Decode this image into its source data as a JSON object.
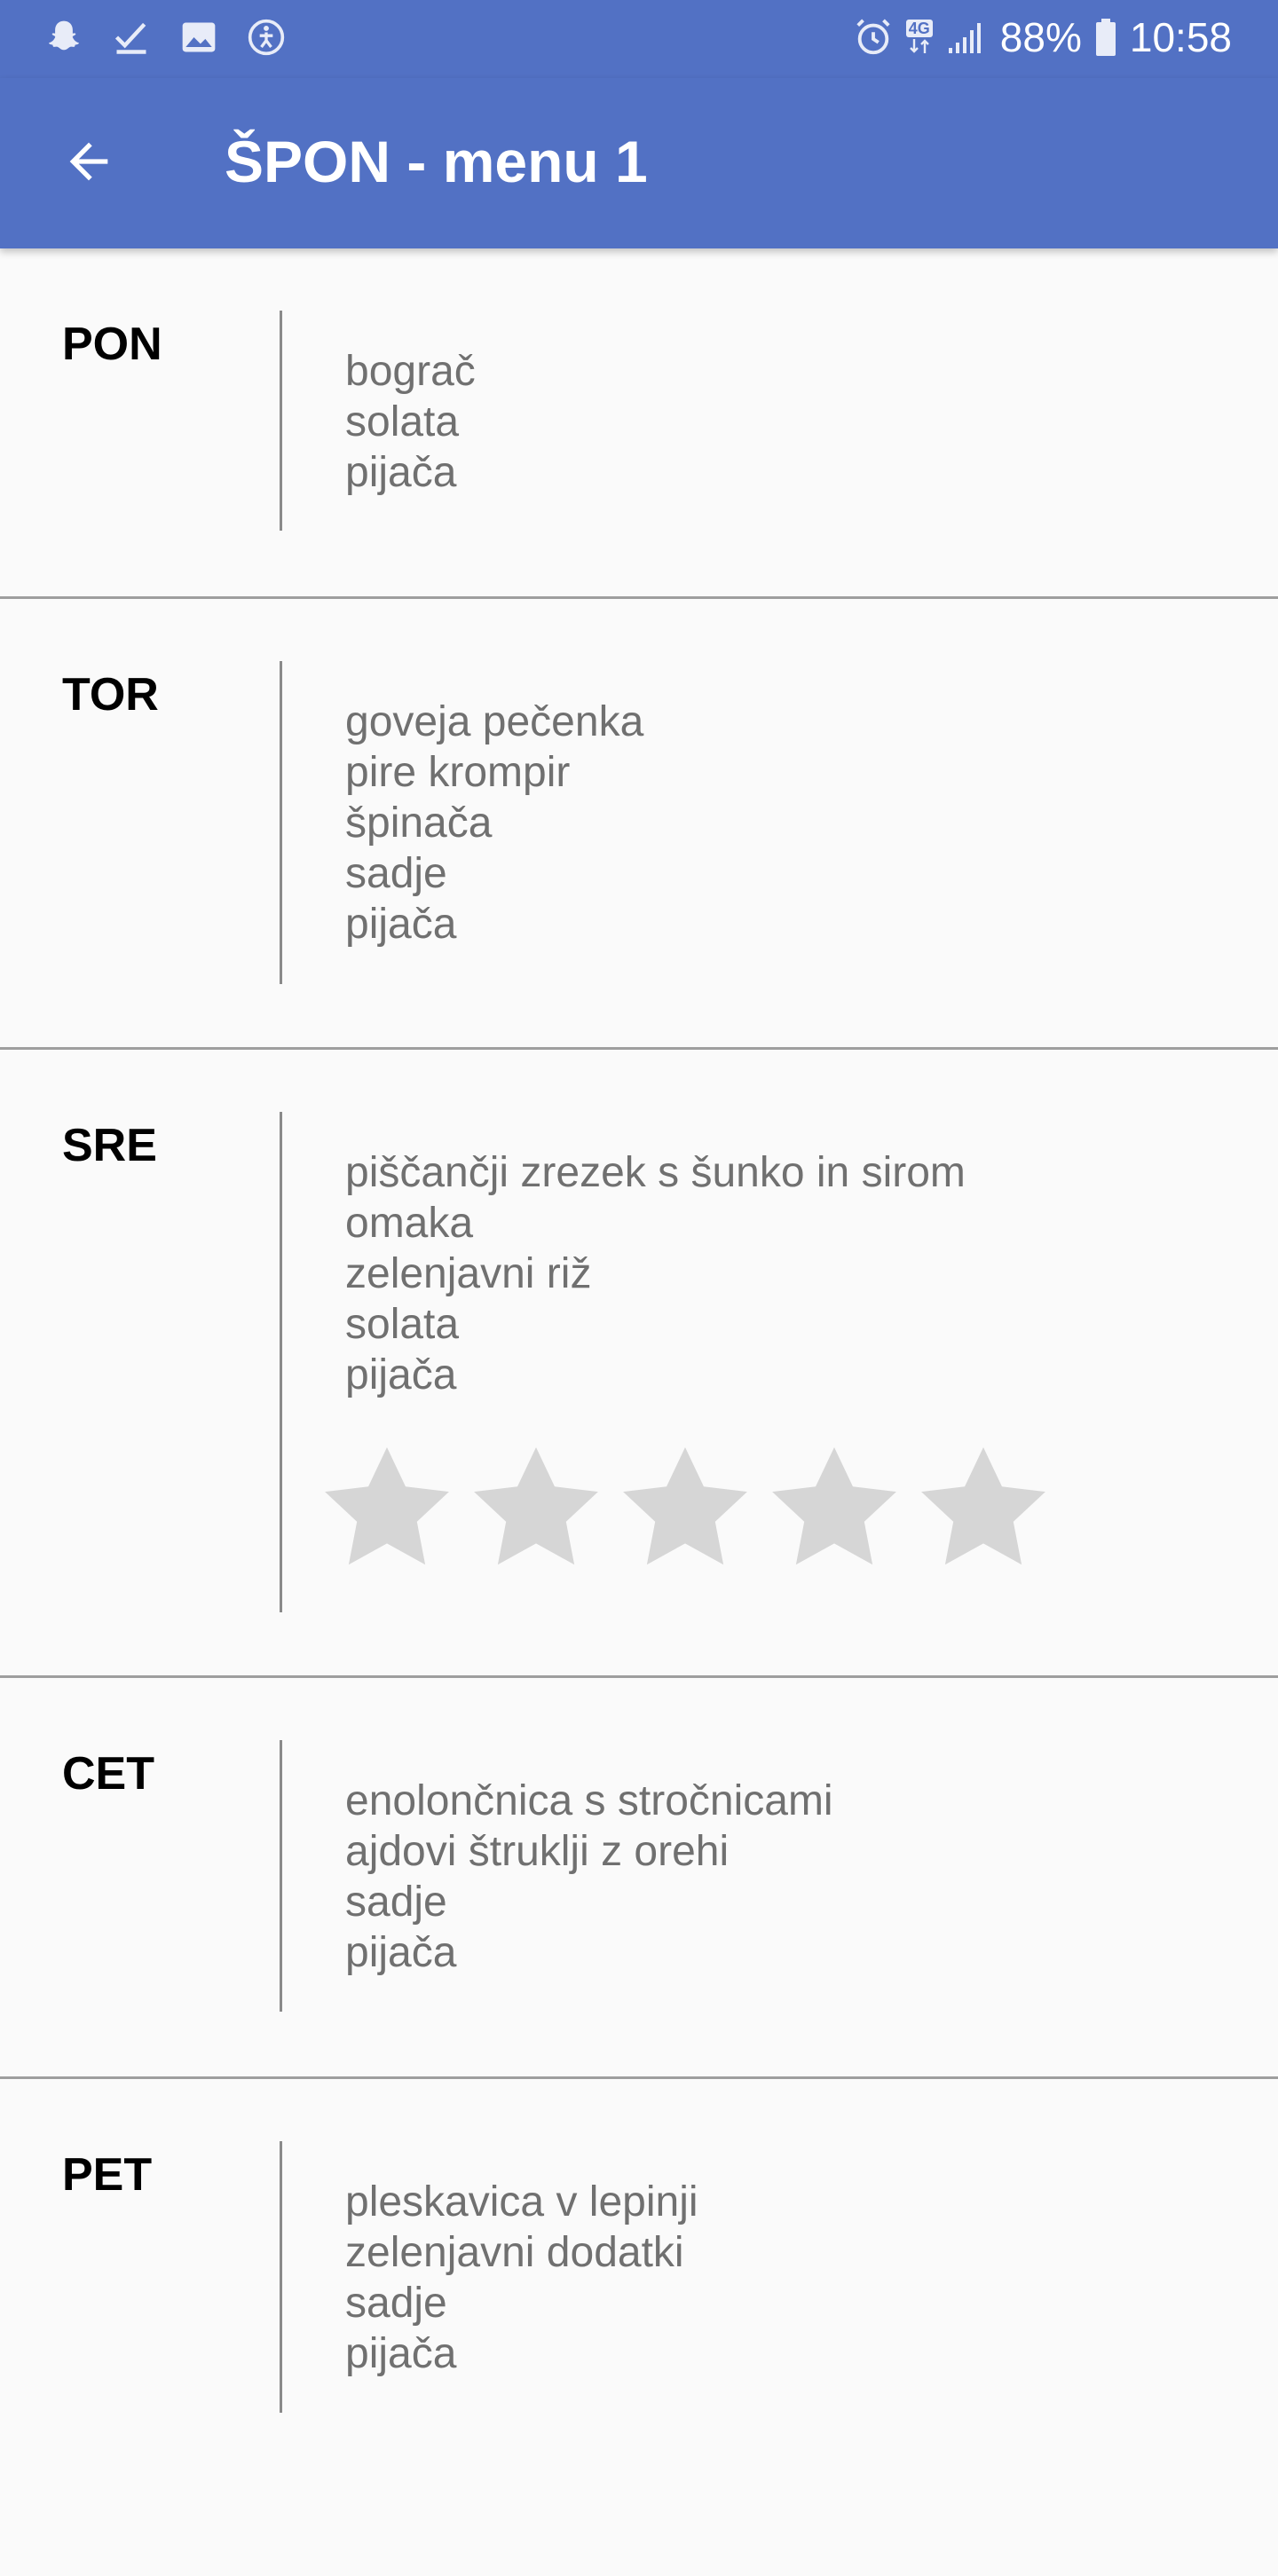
{
  "status_bar": {
    "battery": "88%",
    "time": "10:58",
    "network_badge": "4G",
    "left_icons": [
      "snapchat-icon",
      "check-icon",
      "image-icon",
      "accessibility-icon"
    ],
    "right_icons": [
      "alarm-icon",
      "signal-icon",
      "battery-icon"
    ]
  },
  "toolbar": {
    "title": "ŠPON - menu 1",
    "back_icon": "arrow-back-icon"
  },
  "colors": {
    "primary": "#5271c4",
    "background": "#fafafa",
    "item_text": "#707070",
    "star_empty": "#d6d6d6"
  },
  "days": [
    {
      "label": "PON",
      "items": [
        "bograč",
        "solata",
        "pijača"
      ]
    },
    {
      "label": "TOR",
      "items": [
        "goveja pečenka",
        "pire krompir",
        "špinača",
        "sadje",
        "pijača"
      ]
    },
    {
      "label": "SRE",
      "items": [
        "piščančji zrezek s šunko in sirom",
        "omaka",
        "zelenjavni riž",
        "solata",
        "pijača"
      ],
      "rating": {
        "value": 0,
        "max": 5
      }
    },
    {
      "label": "CET",
      "items": [
        "enolončnica s stročnicami",
        "ajdovi štruklji z orehi",
        "sadje",
        "pijača"
      ]
    },
    {
      "label": "PET",
      "items": [
        "pleskavica v lepinji",
        "zelenjavni dodatki",
        "sadje",
        "pijača"
      ]
    }
  ]
}
